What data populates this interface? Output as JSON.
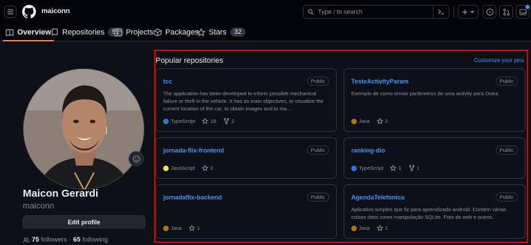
{
  "header": {
    "username": "maiconn",
    "search_placeholder": "Type / to search"
  },
  "tabs": [
    {
      "label": "Overview"
    },
    {
      "label": "Repositories",
      "count": "51"
    },
    {
      "label": "Projects"
    },
    {
      "label": "Packages"
    },
    {
      "label": "Stars",
      "count": "32"
    }
  ],
  "profile": {
    "name": "Maicon Gerardi",
    "login": "maiconn",
    "edit_label": "Edit profile",
    "followers_count": "75",
    "followers_label": "followers",
    "separator": "·",
    "following_count": "65",
    "following_label": "following"
  },
  "popular": {
    "title": "Popular repositories",
    "customize_label": "Customize your pins",
    "repos": [
      {
        "name": "tcc",
        "visibility": "Public",
        "description": "The application has been developed to inform possible mechanical failure or theft in the vehicle. It has as main objectives, to visualize the current location of the car, to obtain images and to ma...",
        "language": "TypeScript",
        "language_color": "#3178c6",
        "stars": "16",
        "forks": "2"
      },
      {
        "name": "TesteActivityParam",
        "visibility": "Public",
        "description": "Exemplo de como enviar parâmetros de uma activity para Outra",
        "language": "Java",
        "language_color": "#b07219",
        "stars": "2"
      },
      {
        "name": "jornada-flix-frontend",
        "visibility": "Public",
        "description": "",
        "language": "JavaScript",
        "language_color": "#f1e05a",
        "stars": "2"
      },
      {
        "name": "ranking-dio",
        "visibility": "Public",
        "description": "",
        "language": "TypeScript",
        "language_color": "#3178c6",
        "stars": "1",
        "forks": "1"
      },
      {
        "name": "jornadaflix-backend",
        "visibility": "Public",
        "description": "",
        "language": "Java",
        "language_color": "#b07219",
        "stars": "1"
      },
      {
        "name": "AgendaTelefonica",
        "visibility": "Public",
        "description": "Aplicativo simples que fiz para aprendizado android. Contém várias coisas úteis como manipulação SQLite, Foto da web e outros.",
        "language": "Java",
        "language_color": "#b07219",
        "stars": "1"
      }
    ]
  },
  "colors": {
    "background": "#0d1117",
    "header": "#010409",
    "accent_link": "#4493f8",
    "tab_underline": "#f78166",
    "highlight_border": "#e00000",
    "notification_dot": "#4493f8"
  },
  "icons": [
    "hamburger-icon",
    "github-logo-icon",
    "search-icon",
    "command-palette-icon",
    "plus-icon",
    "issues-icon",
    "pull-request-icon",
    "inbox-icon",
    "book-icon",
    "repo-icon",
    "table-icon",
    "package-icon",
    "star-icon",
    "people-icon",
    "smiley-icon",
    "fork-icon"
  ]
}
